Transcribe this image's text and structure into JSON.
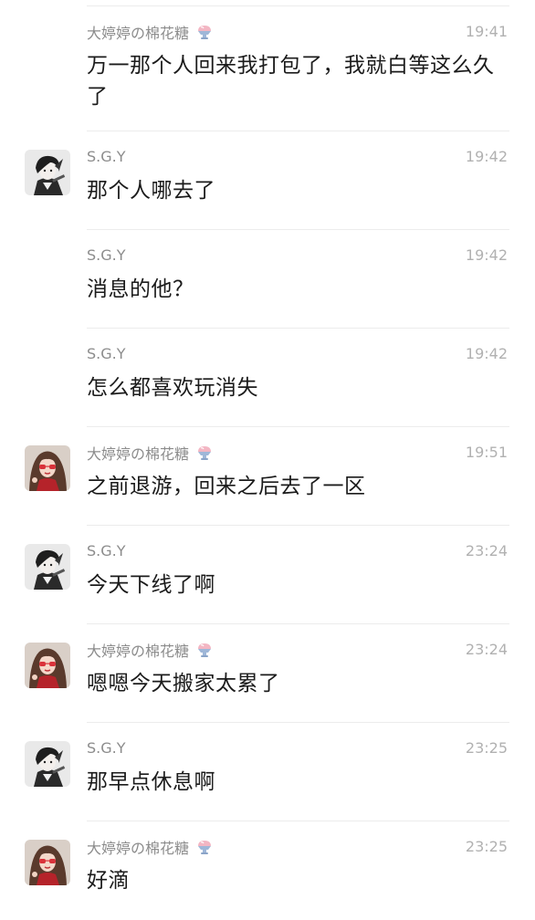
{
  "messages": [
    {
      "avatar": "none",
      "sender": "大婷婷の棉花糖",
      "time": "19:41",
      "text": "万一那个人回来我打包了，我就白等这么久了",
      "has_emoji": true
    },
    {
      "avatar": "boy-avatar",
      "sender": "S.G.Y",
      "time": "19:42",
      "text": "那个人哪去了",
      "has_emoji": false
    },
    {
      "avatar": "none",
      "sender": "S.G.Y",
      "time": "19:42",
      "text": "消息的他？",
      "has_emoji": false
    },
    {
      "avatar": "none",
      "sender": "S.G.Y",
      "time": "19:42",
      "text": "怎么都喜欢玩消失",
      "has_emoji": false
    },
    {
      "avatar": "girl-avatar",
      "sender": "大婷婷の棉花糖",
      "time": "19:51",
      "text": "之前退游，回来之后去了一区",
      "has_emoji": true
    },
    {
      "avatar": "boy-avatar",
      "sender": "S.G.Y",
      "time": "23:24",
      "text": "今天下线了啊",
      "has_emoji": false
    },
    {
      "avatar": "girl-avatar",
      "sender": "大婷婷の棉花糖",
      "time": "23:24",
      "text": "嗯嗯今天搬家太累了",
      "has_emoji": true
    },
    {
      "avatar": "boy-avatar",
      "sender": "S.G.Y",
      "time": "23:25",
      "text": "那早点休息啊",
      "has_emoji": false
    },
    {
      "avatar": "girl-avatar",
      "sender": "大婷婷の棉花糖",
      "time": "23:25",
      "text": "好滴",
      "has_emoji": true
    }
  ],
  "colors": {
    "name": "#8c8c8c",
    "time": "#b1b1b1",
    "text": "#1b1b1b",
    "separator": "#ececec"
  }
}
